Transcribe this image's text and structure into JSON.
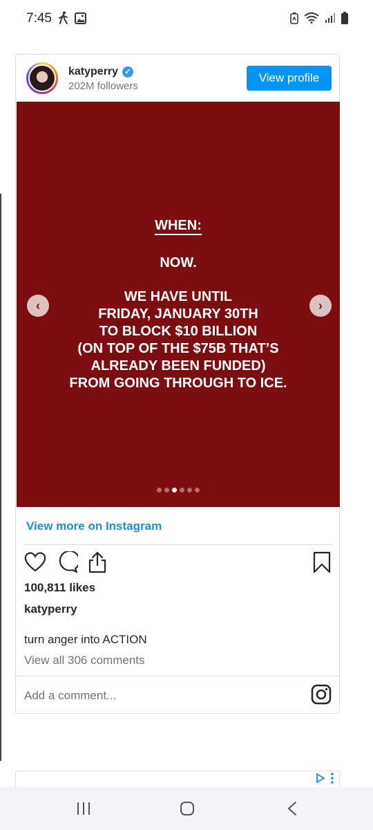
{
  "status_bar": {
    "time": "7:45"
  },
  "profile": {
    "username": "katyperry",
    "followers": "202M followers",
    "view_profile_label": "View profile"
  },
  "post": {
    "heading": "WHEN:",
    "subheading": "NOW.",
    "message": "WE HAVE UNTIL\nFRIDAY, JANUARY 30TH\nTO BLOCK $10 BILLION\n(ON TOP OF THE $75B THAT’S\nALREADY BEEN FUNDED)\nFROM GOING THROUGH TO ICE.",
    "background_color": "#7d0e0f",
    "carousel_total": 6,
    "carousel_active_index": 2
  },
  "links": {
    "view_more": "View more on Instagram"
  },
  "engagement": {
    "likes": "100,811 likes",
    "post_user": "katyperry",
    "caption": "turn anger into ACTION",
    "view_comments": "View all 306 comments",
    "comment_placeholder": "Add a comment..."
  },
  "colors": {
    "accent": "#0095f6",
    "link": "#1a8fd8",
    "verified": "#3897f0"
  },
  "icons": [
    "walk-icon",
    "gallery-icon",
    "battery-saver-icon",
    "wifi-icon",
    "signal-icon",
    "battery-icon",
    "verified-icon",
    "chevron-left-icon",
    "chevron-right-icon",
    "heart-icon",
    "comment-icon",
    "share-icon",
    "bookmark-icon",
    "instagram-icon",
    "ad-choices-icon",
    "more-vert-icon",
    "recents-icon",
    "home-icon",
    "back-icon"
  ]
}
